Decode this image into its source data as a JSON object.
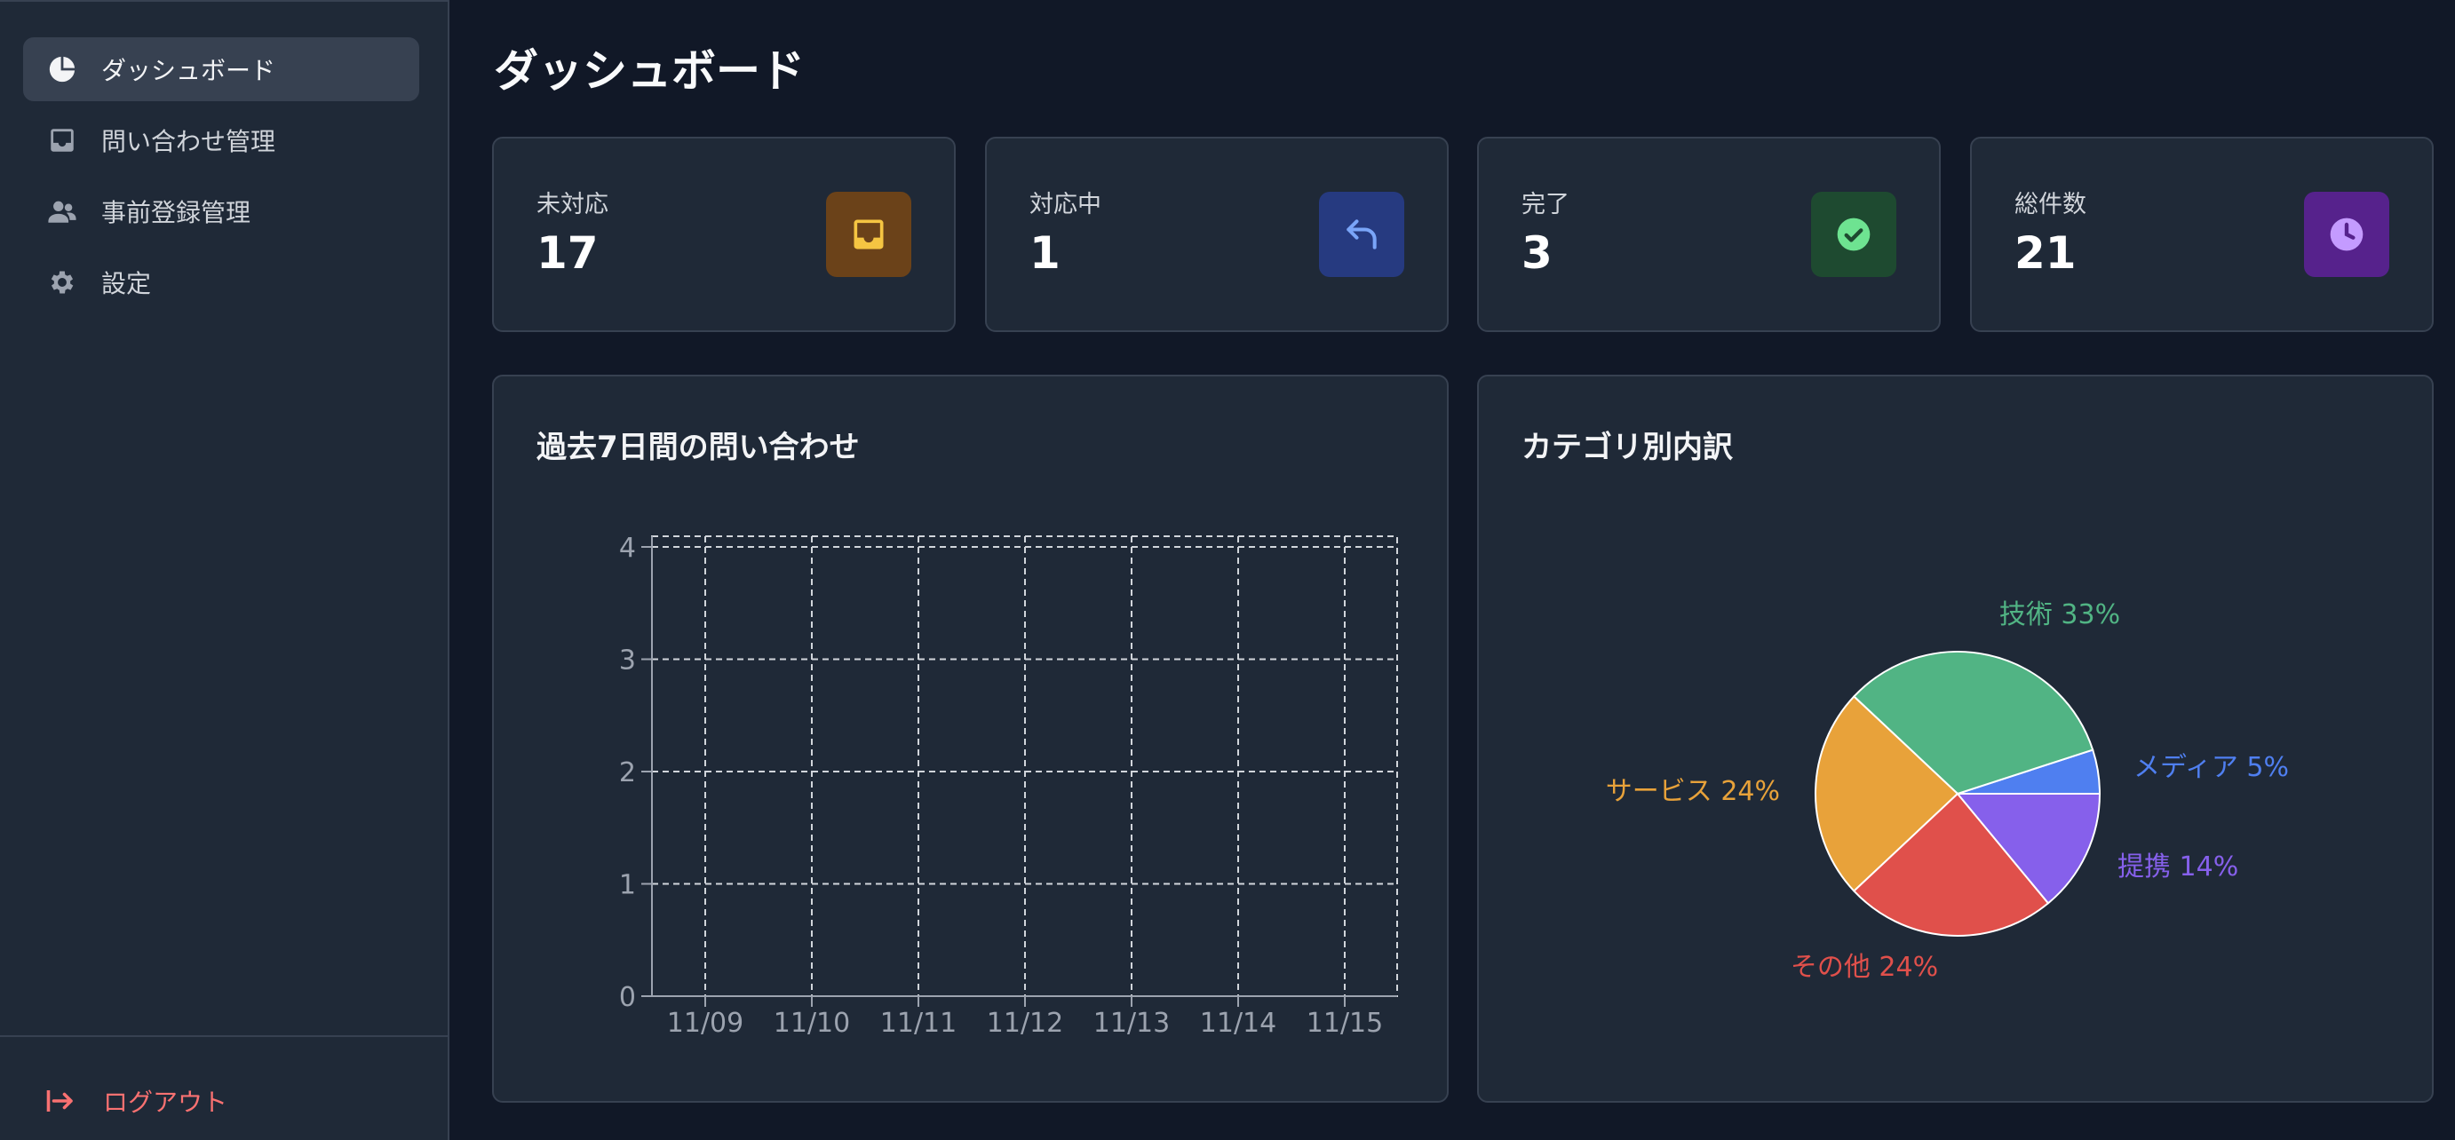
{
  "sidebar": {
    "items": [
      {
        "label": "ダッシュボード",
        "icon": "pie-chart-icon"
      },
      {
        "label": "問い合わせ管理",
        "icon": "inbox-icon"
      },
      {
        "label": "事前登録管理",
        "icon": "users-icon"
      },
      {
        "label": "設定",
        "icon": "gear-icon"
      }
    ],
    "logout_label": "ログアウト"
  },
  "page": {
    "title": "ダッシュボード"
  },
  "stats": [
    {
      "label": "未対応",
      "value": "17",
      "icon": "inbox-icon",
      "color": "#f5c542",
      "bg": "#6b4219"
    },
    {
      "label": "対応中",
      "value": "1",
      "icon": "reply-icon",
      "color": "#7aa5f8",
      "bg": "#263a80"
    },
    {
      "label": "完了",
      "value": "3",
      "icon": "check-circle-icon",
      "color": "#6ee391",
      "bg": "#1e4a30"
    },
    {
      "label": "総件数",
      "value": "21",
      "icon": "clock-icon",
      "color": "#c49bff",
      "bg": "#56228c"
    }
  ],
  "line_panel": {
    "title": "過去7日間の問い合わせ"
  },
  "pie_panel": {
    "title": "カテゴリ別内訳"
  },
  "chart_data": [
    {
      "type": "line",
      "x": [
        "11/09",
        "11/10",
        "11/11",
        "11/12",
        "11/13",
        "11/14",
        "11/15"
      ],
      "series": [],
      "ylim": [
        0,
        4
      ],
      "yticks": [
        "0",
        "1",
        "2",
        "3",
        "4"
      ],
      "grid": true
    },
    {
      "type": "pie",
      "slices": [
        {
          "label": "メディア 5%",
          "value": 5,
          "color": "#4f7ff0"
        },
        {
          "label": "技術 33%",
          "value": 33,
          "color": "#51b484"
        },
        {
          "label": "サービス 24%",
          "value": 24,
          "color": "#e8a23a"
        },
        {
          "label": "その他 24%",
          "value": 24,
          "color": "#e0504b"
        },
        {
          "label": "提携 14%",
          "value": 14,
          "color": "#8660eb"
        }
      ]
    }
  ]
}
